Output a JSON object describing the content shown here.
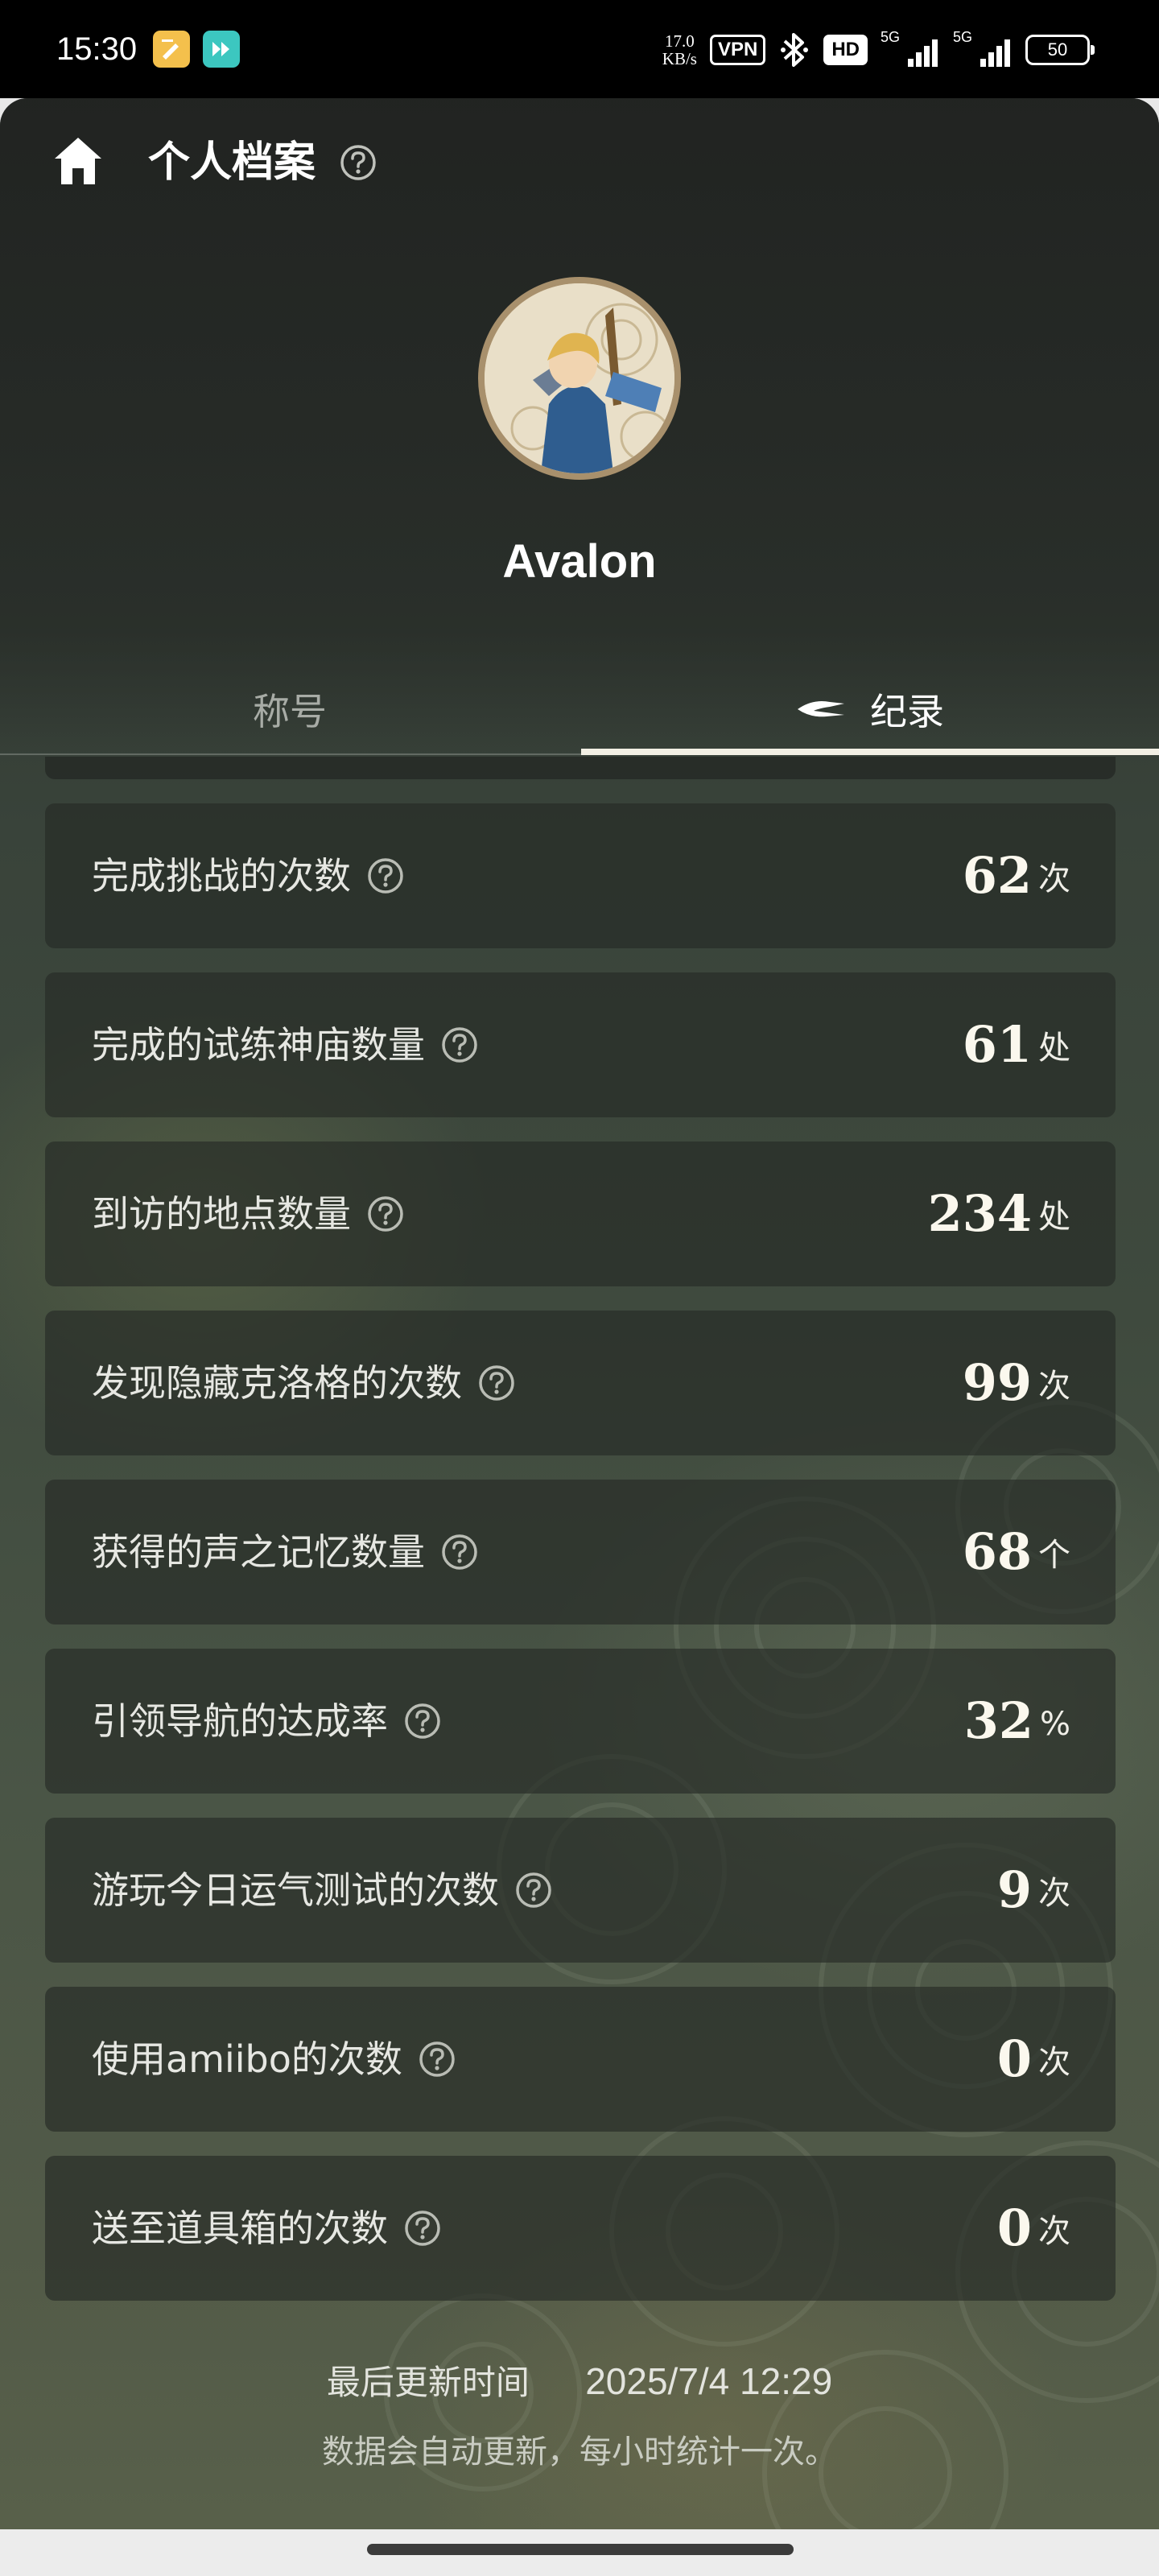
{
  "status_bar": {
    "time": "15:30",
    "net_speed_value": "17.0",
    "net_speed_unit": "KB/s",
    "vpn_label": "VPN",
    "hd_label": "HD",
    "signal_1_label": "5G",
    "signal_2_label": "5G",
    "battery_level": "50"
  },
  "header": {
    "title": "个人档案"
  },
  "profile": {
    "username": "Avalon"
  },
  "tabs": [
    {
      "label": "称号",
      "active": false
    },
    {
      "label": "纪录",
      "active": true
    }
  ],
  "stats": [
    {
      "label": "完成挑战的次数",
      "value": "62",
      "unit": "次"
    },
    {
      "label": "完成的试练神庙数量",
      "value": "61",
      "unit": "处"
    },
    {
      "label": "到访的地点数量",
      "value": "234",
      "unit": "处"
    },
    {
      "label": "发现隐藏克洛格的次数",
      "value": "99",
      "unit": "次"
    },
    {
      "label": "获得的声之记忆数量",
      "value": "68",
      "unit": "个"
    },
    {
      "label": "引领导航的达成率",
      "value": "32",
      "unit": "%"
    },
    {
      "label": "游玩今日运气测试的次数",
      "value": "9",
      "unit": "次"
    },
    {
      "label": "使用amiibo的次数",
      "value": "0",
      "unit": "次"
    },
    {
      "label": "送至道具箱的次数",
      "value": "0",
      "unit": "次"
    }
  ],
  "footer": {
    "updated_label": "最后更新时间",
    "updated_time": "2025/7/4 12:29",
    "note": "数据会自动更新，每小时统计一次。"
  },
  "colors": {
    "accent": "#f2efe4",
    "card_bg": "#262a26"
  }
}
